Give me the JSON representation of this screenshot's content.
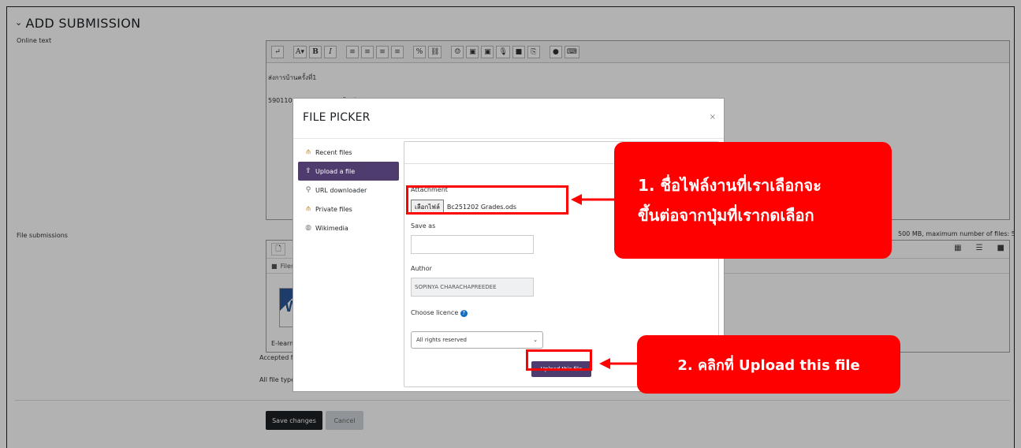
{
  "section": {
    "title": "ADD SUBMISSION"
  },
  "labels": {
    "online_text": "Online text",
    "file_submissions": "File submissions"
  },
  "editor": {
    "toolbar_buttons": [
      "↵",
      "A▾",
      "B",
      "I",
      "≡",
      "≡",
      "≡",
      "≡",
      "%",
      "⛓",
      "☺",
      "▣",
      "▣",
      "🎙",
      "■",
      "⎘",
      "●",
      "⌨"
    ],
    "line1": "ส่งการบ้านครั้งที่1",
    "line2": "5901102091013 นาย กอไก่ ตัวอย่าง BCR2"
  },
  "files": {
    "crumb": "Files",
    "file_name": "E-learning",
    "info": "500 MB, maximum number of files: 5",
    "accepted_prefix": "Accepted fi",
    "all_types_prefix": "All file type"
  },
  "buttons": {
    "save": "Save changes",
    "cancel": "Cancel"
  },
  "modal": {
    "title": "FILE PICKER",
    "close": "×",
    "repos": [
      {
        "label": "Recent files",
        "icon": "folder-tree-icon"
      },
      {
        "label": "Upload a file",
        "icon": "upload-icon"
      },
      {
        "label": "URL downloader",
        "icon": "url-icon"
      },
      {
        "label": "Private files",
        "icon": "folder-tree-icon"
      },
      {
        "label": "Wikimedia",
        "icon": "wikimedia-icon"
      }
    ],
    "attachment_label": "Attachment",
    "choose_file_button": "เลือกไฟล์",
    "chosen_file": "Bc251202 Grades.ods",
    "save_as_label": "Save as",
    "save_as_value": "",
    "author_label": "Author",
    "author_value": "SOPINYA CHARACHAPREEDEE",
    "licence_label": "Choose licence",
    "licence_value": "All rights reserved",
    "upload_button": "Upload this file"
  },
  "annotations": {
    "callout1_line1": "1. ชื่อไฟล์งานที่เราเลือกจะ",
    "callout1_line2": "ขึ้นต่อจากปุ่มที่เรากดเลือก",
    "callout2": "2. คลิกที่ Upload this file",
    "color": "#ff0000"
  },
  "colors": {
    "primary_button": "#4f3c6e",
    "save_button": "#1d2125"
  }
}
